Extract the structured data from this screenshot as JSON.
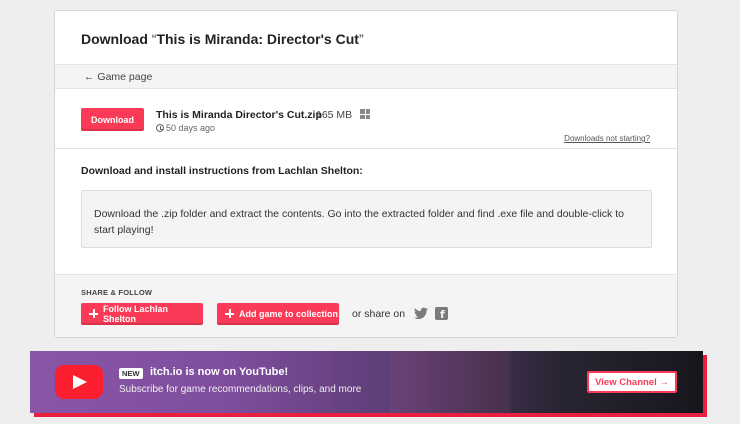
{
  "page": {
    "title_prefix": "Download",
    "title_open_quote": "“",
    "title_name": "This is Miranda: Director's Cut",
    "title_close_quote": "”",
    "back_link": "← Game page"
  },
  "download": {
    "button_label": "Download",
    "file_name": "This is Miranda Director's Cut.zip",
    "file_size": "165 MB",
    "platform_icon": "windows-icon",
    "age": "50 days ago",
    "not_starting_link": "Downloads not starting?"
  },
  "instructions": {
    "heading": "Download and install instructions from Lachlan Shelton:",
    "text": "Download the .zip folder and extract the contents. Go into the extracted folder and find .exe file and double-click to start playing!"
  },
  "share": {
    "heading": "SHARE & FOLLOW",
    "follow_label": "Follow Lachlan Shelton",
    "collection_label": "Add game to collection",
    "share_on": "or share on"
  },
  "banner": {
    "badge": "NEW",
    "title": "itch.io is now on YouTube!",
    "subtitle": "Subscribe for game recommendations, clips, and more",
    "button_label": "View Channel →"
  },
  "colors": {
    "accent": "#fa3a56",
    "youtube": "#fa1e2e"
  }
}
